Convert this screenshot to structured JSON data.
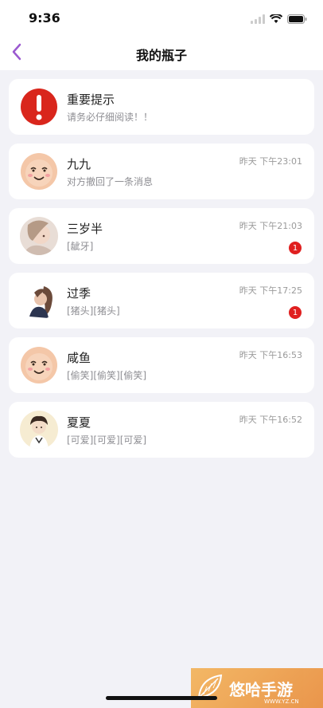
{
  "status_bar": {
    "time": "9:36"
  },
  "nav": {
    "title": "我的瓶子"
  },
  "colors": {
    "accent": "#9b59d0",
    "badge": "#e02020",
    "alert": "#d9261c"
  },
  "conversations": [
    {
      "name": "重要提示",
      "preview": "请务必仔细阅读！！",
      "time": "",
      "badge": "",
      "avatar_icon": "alert-icon"
    },
    {
      "name": "九九",
      "preview": "对方撤回了一条消息",
      "time": "昨天 下午23:01",
      "badge": "",
      "avatar_icon": "smiley-avatar"
    },
    {
      "name": "三岁半",
      "preview": "[龇牙]",
      "time": "昨天 下午21:03",
      "badge": "1",
      "avatar_icon": "photo-avatar"
    },
    {
      "name": "过季",
      "preview": "[猪头][猪头]",
      "time": "昨天 下午17:25",
      "badge": "1",
      "avatar_icon": "photo-avatar"
    },
    {
      "name": "咸鱼",
      "preview": "[偷笑][偷笑][偷笑]",
      "time": "昨天 下午16:53",
      "badge": "",
      "avatar_icon": "smiley-avatar"
    },
    {
      "name": "夏夏",
      "preview": "[可爱][可爱][可爱]",
      "time": "昨天 下午16:52",
      "badge": "",
      "avatar_icon": "photo-avatar"
    }
  ],
  "watermark": {
    "text": "悠哈手游",
    "sub": "WWW.YZ.CN"
  }
}
